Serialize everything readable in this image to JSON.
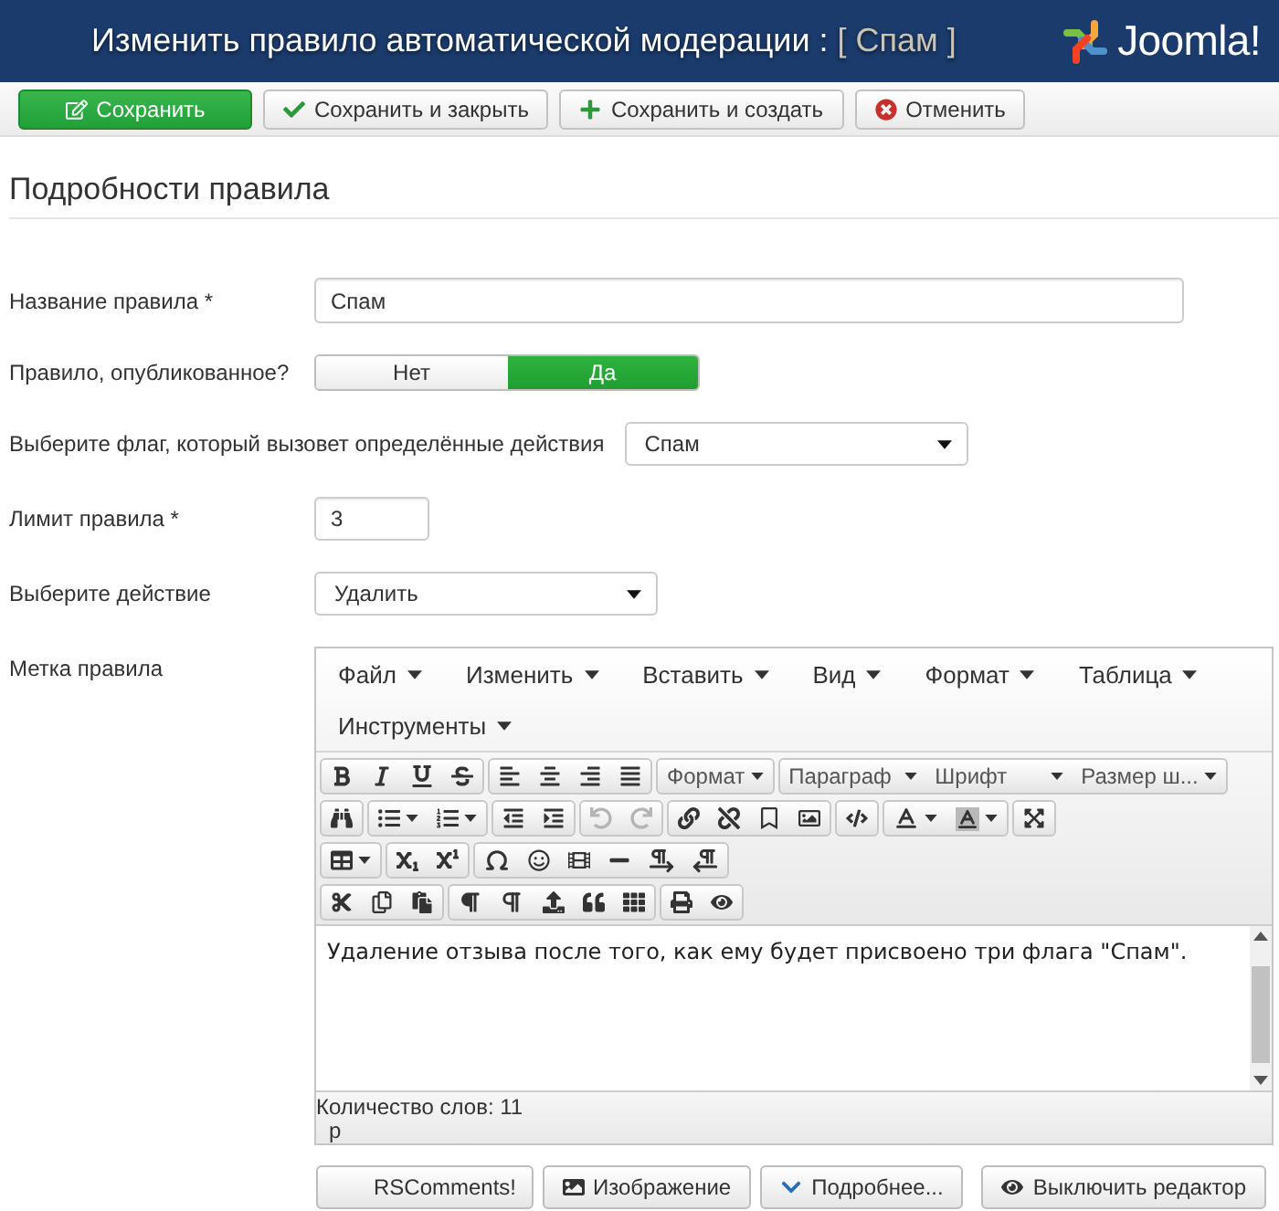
{
  "header": {
    "title": "Изменить правило автоматической модерации :",
    "record": "[ Спам ]",
    "logo": "Joomla!"
  },
  "actions": [
    {
      "kind": "save",
      "label": "Сохранить",
      "primary": true
    },
    {
      "kind": "saveclose",
      "label": "Сохранить и закрыть",
      "primary": false
    },
    {
      "kind": "savenew",
      "label": "Сохранить и создать",
      "primary": false
    },
    {
      "kind": "cancel",
      "label": "Отменить",
      "primary": false
    }
  ],
  "section_title": "Подробности правила",
  "fields": [
    {
      "kind": "text",
      "label": "Название правила *",
      "value": "Спам"
    },
    {
      "kind": "toggle",
      "label": "Правило, опубликованное?",
      "options": [
        {
          "label": "Нет",
          "selected": false
        },
        {
          "label": "Да",
          "selected": true
        }
      ]
    },
    {
      "kind": "select",
      "label": "Выберите флаг, который вызовет определённые действия",
      "value": "Спам"
    },
    {
      "kind": "number",
      "label": "Лимит правила *",
      "value": "3"
    },
    {
      "kind": "select",
      "label": "Выберите действие",
      "value": "Удалить"
    },
    {
      "kind": "editor",
      "label": "Метка правила",
      "menu": [
        {
          "label": "Файл"
        },
        {
          "label": "Изменить"
        },
        {
          "label": "Вставить"
        },
        {
          "label": "Вид"
        },
        {
          "label": "Формат"
        },
        {
          "label": "Таблица"
        },
        {
          "label": "Инструменты"
        }
      ],
      "toolbar": [
        [
          [
            {
              "kind": "bold",
              "disabled": false
            },
            {
              "kind": "italic",
              "disabled": false
            },
            {
              "kind": "underline",
              "disabled": false
            },
            {
              "kind": "strikethrough",
              "disabled": false
            }
          ],
          [
            {
              "kind": "alignleft",
              "disabled": false
            },
            {
              "kind": "aligncenter",
              "disabled": false
            },
            {
              "kind": "alignright",
              "disabled": false
            },
            {
              "kind": "alignjustify",
              "disabled": false
            }
          ],
          [
            {
              "kind": "menubutton",
              "label": "Формат",
              "disabled": false
            }
          ],
          [
            {
              "kind": "listbox",
              "label": "Параграф",
              "disabled": false
            },
            {
              "kind": "listbox",
              "label": "Шрифт",
              "disabled": false
            },
            {
              "kind": "listbox",
              "label": "Размер ш...",
              "disabled": false
            }
          ]
        ],
        [
          [
            {
              "kind": "searchreplace",
              "disabled": false
            }
          ],
          [
            {
              "kind": "bullist",
              "menu": true,
              "disabled": false
            },
            {
              "kind": "numlist",
              "menu": true,
              "disabled": false
            }
          ],
          [
            {
              "kind": "outdent",
              "disabled": false
            },
            {
              "kind": "indent",
              "disabled": false
            }
          ],
          [
            {
              "kind": "undo",
              "disabled": true
            },
            {
              "kind": "redo",
              "disabled": true
            }
          ],
          [
            {
              "kind": "link",
              "disabled": false
            },
            {
              "kind": "unlink",
              "disabled": false
            },
            {
              "kind": "anchor",
              "disabled": false
            },
            {
              "kind": "image",
              "disabled": false
            }
          ],
          [
            {
              "kind": "code",
              "disabled": false
            }
          ],
          [
            {
              "kind": "forecolor",
              "menu": true,
              "disabled": false
            },
            {
              "kind": "backcolor",
              "menu": true,
              "disabled": false
            }
          ],
          [
            {
              "kind": "fullscreen",
              "disabled": false
            }
          ]
        ],
        [
          [
            {
              "kind": "table",
              "menu": true,
              "disabled": false
            }
          ],
          [
            {
              "kind": "subscript",
              "disabled": false
            },
            {
              "kind": "superscript",
              "disabled": false
            }
          ],
          [
            {
              "kind": "charmap",
              "disabled": false
            },
            {
              "kind": "emoticons",
              "disabled": false
            },
            {
              "kind": "media",
              "disabled": false
            },
            {
              "kind": "hr",
              "disabled": false
            },
            {
              "kind": "ltr",
              "disabled": false
            },
            {
              "kind": "rtl",
              "disabled": false
            }
          ]
        ],
        [
          [
            {
              "kind": "cut",
              "disabled": false
            },
            {
              "kind": "copy",
              "disabled": false
            },
            {
              "kind": "paste",
              "disabled": false
            }
          ],
          [
            {
              "kind": "visualchars",
              "disabled": false
            },
            {
              "kind": "visualblocks",
              "disabled": false
            },
            {
              "kind": "insertfile",
              "disabled": false
            },
            {
              "kind": "blockquote",
              "disabled": false
            },
            {
              "kind": "template",
              "disabled": false
            }
          ],
          [
            {
              "kind": "print",
              "disabled": false
            },
            {
              "kind": "preview",
              "disabled": false
            }
          ]
        ]
      ],
      "content": "Удаление отзыва после того, как ему будет присвоено три флага \"Спам\".",
      "word_count": "Количество слов: 11",
      "path": "p",
      "buttons": [
        {
          "kind": "plugin",
          "label": "RSComments!"
        },
        {
          "kind": "image",
          "label": "Изображение"
        },
        {
          "kind": "more",
          "label": "Подробнее..."
        },
        {
          "kind": "toggle",
          "label": "Выключить редактор"
        }
      ]
    }
  ]
}
